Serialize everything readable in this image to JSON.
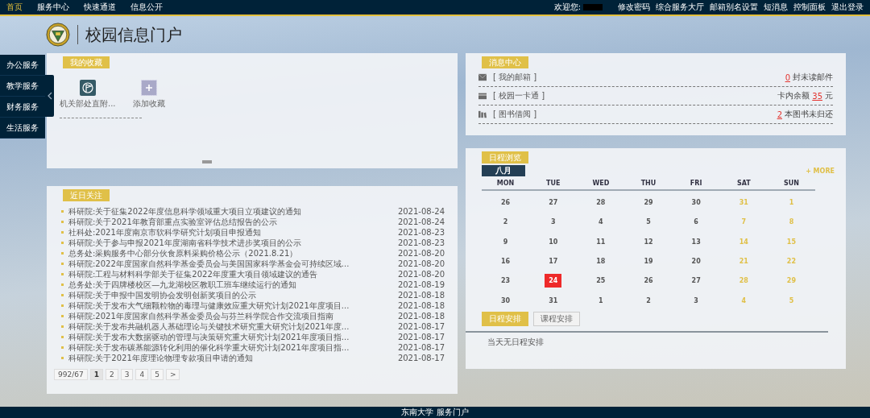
{
  "top_nav": {
    "items": [
      {
        "label": "首页",
        "selected": true
      },
      {
        "label": "服务中心",
        "selected": false
      },
      {
        "label": "快速通道",
        "selected": false
      },
      {
        "label": "信息公开",
        "selected": false
      }
    ],
    "welcome": "欢迎您:",
    "links": [
      "修改密码",
      "综合服务大厅",
      "邮箱别名设置",
      "短消息",
      "控制面板",
      "退出登录"
    ]
  },
  "header": {
    "title": "校园信息门户"
  },
  "sidebar": {
    "items": [
      "办公服务",
      "教学服务",
      "财务服务",
      "生活服务"
    ]
  },
  "favorites": {
    "title": "我的收藏",
    "items": [
      {
        "kind": "app",
        "label": "机关部处直附..."
      },
      {
        "kind": "add",
        "label": "添加收藏"
      }
    ]
  },
  "recent": {
    "title": "近日关注",
    "items": [
      {
        "title": "科研院:关于征集2022年度信息科学领域重大项目立项建议的通知",
        "date": "2021-08-24"
      },
      {
        "title": "科研院:关于2021年教育部重点实验室评估总结报告的公示",
        "date": "2021-08-24"
      },
      {
        "title": "社科处:2021年度南京市软科学研究计划项目申报通知",
        "date": "2021-08-23"
      },
      {
        "title": "科研院:关于参与申报2021年度湖南省科学技术进步奖项目的公示",
        "date": "2021-08-23"
      },
      {
        "title": "总务处:采购服务中心部分伙食原料采购价格公示（2021.8.21）",
        "date": "2021-08-20"
      },
      {
        "title": "科研院:2022年度国家自然科学基金委员会与美国国家科学基金会可持续区域...",
        "date": "2021-08-20"
      },
      {
        "title": "科研院:工程与材料科学部关于征集2022年度重大项目领域建议的通告",
        "date": "2021-08-20"
      },
      {
        "title": "总务处:关于四牌楼校区—九龙湖校区教职工班车继续运行的通知",
        "date": "2021-08-19"
      },
      {
        "title": "科研院:关于申报中国发明协会发明创新奖项目的公示",
        "date": "2021-08-18"
      },
      {
        "title": "科研院:关于发布大气细颗粒物的毒理与健康效应重大研究计划2021年度项目...",
        "date": "2021-08-18"
      },
      {
        "title": "科研院:2021年度国家自然科学基金委员会与芬兰科学院合作交流项目指南",
        "date": "2021-08-18"
      },
      {
        "title": "科研院:关于发布共融机器人基础理论与关键技术研究重大研究计划2021年度...",
        "date": "2021-08-17"
      },
      {
        "title": "科研院:关于发布大数据驱动的管理与决策研究重大研究计划2021年度项目指...",
        "date": "2021-08-17"
      },
      {
        "title": "科研院:关于发布碳基能源转化利用的催化科学重大研究计划2021年度项目指...",
        "date": "2021-08-17"
      },
      {
        "title": "科研院:关于2021年度理论物理专款项目申请的通知",
        "date": "2021-08-17"
      }
    ],
    "pager": {
      "summary": "992/67",
      "pages": [
        {
          "label": "1",
          "selected": true
        },
        {
          "label": "2",
          "selected": false
        },
        {
          "label": "3",
          "selected": false
        },
        {
          "label": "4",
          "selected": false
        },
        {
          "label": "5",
          "selected": false
        }
      ],
      "next": ">"
    }
  },
  "messages": {
    "title": "消息中心",
    "rows": [
      {
        "kind": "mail",
        "label": "[ 我的邮箱 ]",
        "prefix": "",
        "value": "0",
        "suffix": "封未读邮件"
      },
      {
        "kind": "card",
        "label": "[ 校园一卡通 ]",
        "prefix": "卡内余额",
        "value": "35",
        "suffix": "元"
      },
      {
        "kind": "book",
        "label": "[ 图书借阅 ]",
        "prefix": "",
        "value": "2",
        "suffix": "本图书未归还"
      }
    ]
  },
  "calendar": {
    "title": "日程浏览",
    "month": "八月",
    "more": "+ MORE",
    "weekdays": [
      "MON",
      "TUE",
      "WED",
      "THU",
      "FRI",
      "SAT",
      "SUN"
    ],
    "weeks": [
      [
        {
          "day": "26",
          "selected": false
        },
        {
          "day": "27",
          "selected": false
        },
        {
          "day": "28",
          "selected": false
        },
        {
          "day": "29",
          "selected": false
        },
        {
          "day": "30",
          "selected": false
        },
        {
          "day": "31",
          "selected": false
        },
        {
          "day": "1",
          "selected": false
        }
      ],
      [
        {
          "day": "2",
          "selected": false
        },
        {
          "day": "3",
          "selected": false
        },
        {
          "day": "4",
          "selected": false
        },
        {
          "day": "5",
          "selected": false
        },
        {
          "day": "6",
          "selected": false
        },
        {
          "day": "7",
          "selected": false
        },
        {
          "day": "8",
          "selected": false
        }
      ],
      [
        {
          "day": "9",
          "selected": false
        },
        {
          "day": "10",
          "selected": false
        },
        {
          "day": "11",
          "selected": false
        },
        {
          "day": "12",
          "selected": false
        },
        {
          "day": "13",
          "selected": false
        },
        {
          "day": "14",
          "selected": false
        },
        {
          "day": "15",
          "selected": false
        }
      ],
      [
        {
          "day": "16",
          "selected": false
        },
        {
          "day": "17",
          "selected": false
        },
        {
          "day": "18",
          "selected": false
        },
        {
          "day": "19",
          "selected": false
        },
        {
          "day": "20",
          "selected": false
        },
        {
          "day": "21",
          "selected": false
        },
        {
          "day": "22",
          "selected": false
        }
      ],
      [
        {
          "day": "23",
          "selected": false
        },
        {
          "day": "24",
          "selected": true
        },
        {
          "day": "25",
          "selected": false
        },
        {
          "day": "26",
          "selected": false
        },
        {
          "day": "27",
          "selected": false
        },
        {
          "day": "28",
          "selected": false
        },
        {
          "day": "29",
          "selected": false
        }
      ],
      [
        {
          "day": "30",
          "selected": false
        },
        {
          "day": "31",
          "selected": false
        },
        {
          "day": "1",
          "selected": false
        },
        {
          "day": "2",
          "selected": false
        },
        {
          "day": "3",
          "selected": false
        },
        {
          "day": "4",
          "selected": false
        },
        {
          "day": "5",
          "selected": false
        }
      ]
    ],
    "tabs": [
      {
        "label": "日程安排",
        "selected": true
      },
      {
        "label": "课程安排",
        "selected": false
      }
    ],
    "empty_note": "当天无日程安排"
  },
  "footer": "东南大学 服务门户"
}
